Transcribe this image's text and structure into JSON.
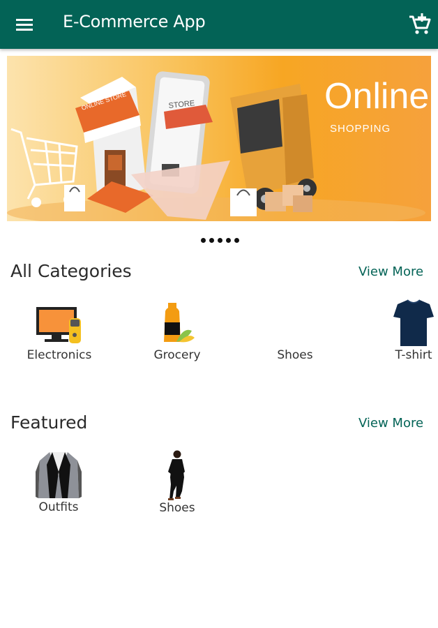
{
  "app": {
    "title": "E-Commerce App",
    "accent_color": "#036356",
    "menu_icon": "menu-icon",
    "cart_icon": "add-shopping-cart-icon"
  },
  "banner": {
    "headline": "Online.",
    "subheadline": "SHOPPING",
    "shop_sign": "ONLINE STORE",
    "phone_sign": "STORE",
    "dot_count": 5
  },
  "categories": {
    "title": "All Categories",
    "view_more": "View More",
    "items": [
      {
        "label": "Electronics",
        "icon": "computer-icon"
      },
      {
        "label": "Grocery",
        "icon": "grocery-icon"
      },
      {
        "label": "Shoes",
        "icon": ""
      },
      {
        "label": "T-shirt",
        "icon": "tshirt-icon"
      }
    ]
  },
  "featured": {
    "title": "Featured",
    "view_more": "View More",
    "items": [
      {
        "label": "Outfits",
        "icon": "blazer-icon"
      },
      {
        "label": "Shoes",
        "icon": "person-icon"
      }
    ]
  }
}
